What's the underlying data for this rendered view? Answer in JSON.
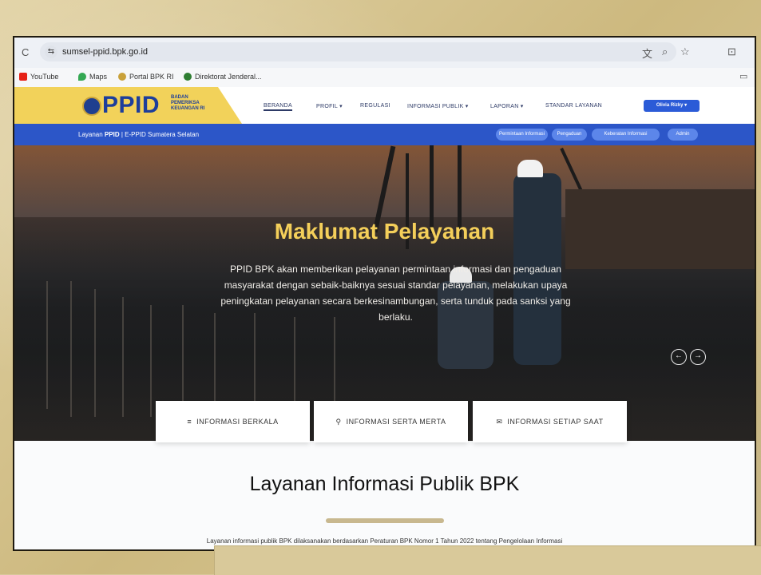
{
  "browser": {
    "url": "sumsel-ppid.bpk.go.id"
  },
  "bookmarks": [
    {
      "label": "YouTube"
    },
    {
      "label": "Maps"
    },
    {
      "label": "Portal BPK RI"
    },
    {
      "label": "Direktorat Jenderal..."
    }
  ],
  "header": {
    "logo_text": "PPID",
    "logo_sub_line1": "BADAN",
    "logo_sub_line2": "PEMERIKSA",
    "logo_sub_line3": "KEUANGAN RI",
    "nav": [
      "BERANDA",
      "PROFIL ▾",
      "REGULASI",
      "INFORMASI PUBLIK ▾",
      "LAPORAN ▾",
      "STANDAR LAYANAN"
    ],
    "user_button": "Olivia Rizky ▾"
  },
  "subbar": {
    "brand_prefix": "Layanan ",
    "brand_bold": "PPID",
    "brand_suffix": " | E-PPID Sumatera Selatan",
    "pills": [
      "Permintaan Informasi",
      "Pengaduan",
      "Keberatan Informasi",
      "Admin"
    ]
  },
  "hero": {
    "title": "Maklumat Pelayanan",
    "text": "PPID BPK akan memberikan pelayanan permintaan informasi dan pengaduan masyarakat dengan sebaik-baiknya sesuai standar pelayanan, melakukan upaya peningkatan pelayanan secara berkesinambungan, serta tunduk pada sanksi yang berlaku."
  },
  "cards": [
    {
      "label": "INFORMASI BERKALA"
    },
    {
      "label": "INFORMASI SERTA MERTA"
    },
    {
      "label": "INFORMASI SETIAP SAAT"
    }
  ],
  "section": {
    "title": "Layanan Informasi Publik BPK",
    "text": "Layanan informasi publik BPK dilaksanakan berdasarkan Peraturan BPK Nomor 1 Tahun 2022 tentang Pengelolaan Informasi"
  },
  "colors": {
    "accent_blue": "#2c56c8",
    "logo_yellow": "#f2d25a",
    "hero_title_yellow": "#f4cf5a"
  }
}
